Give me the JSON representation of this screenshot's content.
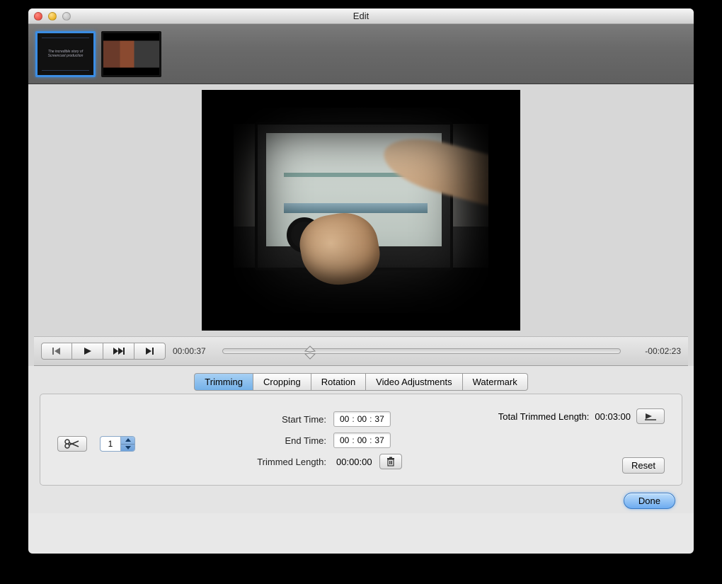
{
  "window": {
    "title": "Edit"
  },
  "playback": {
    "current_time": "00:00:37",
    "remaining_time": "-00:02:23",
    "position_percent": 22
  },
  "tabs": {
    "items": [
      "Trimming",
      "Cropping",
      "Rotation",
      "Video Adjustments",
      "Watermark"
    ],
    "active_index": 0
  },
  "trimming": {
    "segment_count": "1",
    "labels": {
      "start": "Start Time:",
      "end": "End Time:",
      "trimmed_length": "Trimmed Length:",
      "total_trimmed_length": "Total Trimmed Length:"
    },
    "start_time": {
      "hh": "00",
      "mm": "00",
      "ss": "37"
    },
    "end_time": {
      "hh": "00",
      "mm": "00",
      "ss": "37"
    },
    "trimmed_length": "00:00:00",
    "total_trimmed_length": "00:03:00"
  },
  "buttons": {
    "reset": "Reset",
    "done": "Done"
  },
  "thumb1_text": "The incredible story of Screencast production"
}
